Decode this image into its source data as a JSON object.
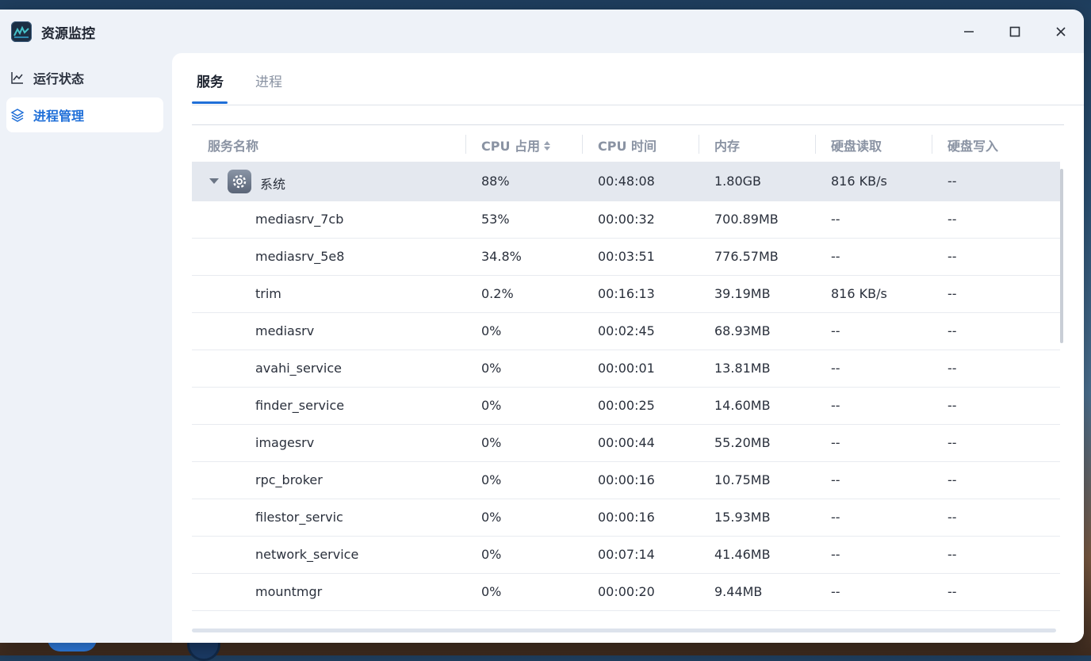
{
  "window": {
    "title": "资源监控"
  },
  "sidebar": {
    "items": [
      {
        "label": "运行状态",
        "icon": "line-chart-icon",
        "active": false
      },
      {
        "label": "进程管理",
        "icon": "layers-icon",
        "active": true
      }
    ]
  },
  "tabs": [
    {
      "label": "服务",
      "active": true
    },
    {
      "label": "进程",
      "active": false
    }
  ],
  "table": {
    "columns": [
      "服务名称",
      "CPU 占用",
      "CPU 时间",
      "内存",
      "硬盘读取",
      "硬盘写入"
    ],
    "sorted_column": "CPU 占用",
    "group": {
      "name": "系统",
      "cpu": "88%",
      "cpu_time": "00:48:08",
      "memory": "1.80GB",
      "disk_read": "816 KB/s",
      "disk_write": "--",
      "expanded": true
    },
    "rows": [
      {
        "name": "mediasrv_7cb",
        "cpu": "53%",
        "cpu_time": "00:00:32",
        "memory": "700.89MB",
        "disk_read": "--",
        "disk_write": "--"
      },
      {
        "name": "mediasrv_5e8",
        "cpu": "34.8%",
        "cpu_time": "00:03:51",
        "memory": "776.57MB",
        "disk_read": "--",
        "disk_write": "--"
      },
      {
        "name": "trim",
        "cpu": "0.2%",
        "cpu_time": "00:16:13",
        "memory": "39.19MB",
        "disk_read": "816 KB/s",
        "disk_write": "--"
      },
      {
        "name": "mediasrv",
        "cpu": "0%",
        "cpu_time": "00:02:45",
        "memory": "68.93MB",
        "disk_read": "--",
        "disk_write": "--"
      },
      {
        "name": "avahi_service",
        "cpu": "0%",
        "cpu_time": "00:00:01",
        "memory": "13.81MB",
        "disk_read": "--",
        "disk_write": "--"
      },
      {
        "name": "finder_service",
        "cpu": "0%",
        "cpu_time": "00:00:25",
        "memory": "14.60MB",
        "disk_read": "--",
        "disk_write": "--"
      },
      {
        "name": "imagesrv",
        "cpu": "0%",
        "cpu_time": "00:00:44",
        "memory": "55.20MB",
        "disk_read": "--",
        "disk_write": "--"
      },
      {
        "name": "rpc_broker",
        "cpu": "0%",
        "cpu_time": "00:00:16",
        "memory": "10.75MB",
        "disk_read": "--",
        "disk_write": "--"
      },
      {
        "name": "filestor_servic",
        "cpu": "0%",
        "cpu_time": "00:00:16",
        "memory": "15.93MB",
        "disk_read": "--",
        "disk_write": "--"
      },
      {
        "name": "network_service",
        "cpu": "0%",
        "cpu_time": "00:07:14",
        "memory": "41.46MB",
        "disk_read": "--",
        "disk_write": "--"
      },
      {
        "name": "mountmgr",
        "cpu": "0%",
        "cpu_time": "00:00:20",
        "memory": "9.44MB",
        "disk_read": "--",
        "disk_write": "--"
      }
    ]
  },
  "colors": {
    "accent": "#1f6fd8",
    "group_row": "#e4e8ef",
    "header_text": "#8a93a3"
  }
}
